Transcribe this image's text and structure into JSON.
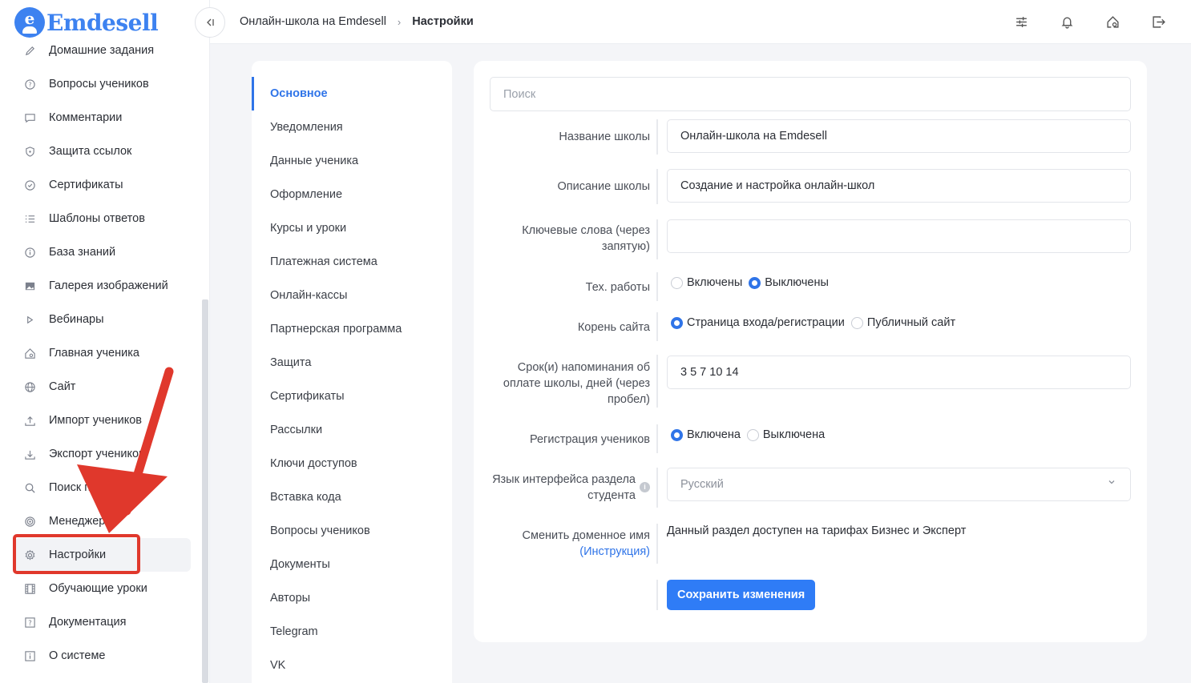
{
  "app": {
    "logo_letter": "e",
    "logo_text": "Emdesell"
  },
  "sidebar": {
    "items": [
      {
        "label": "Домашние задания",
        "icon": "pencil-icon",
        "active": false
      },
      {
        "label": "Вопросы учеников",
        "icon": "question-circle-icon",
        "active": false
      },
      {
        "label": "Комментарии",
        "icon": "comment-icon",
        "active": false
      },
      {
        "label": "Защита ссылок",
        "icon": "shield-icon",
        "active": false
      },
      {
        "label": "Сертификаты",
        "icon": "check-circle-icon",
        "active": false
      },
      {
        "label": "Шаблоны ответов",
        "icon": "list-icon",
        "active": false
      },
      {
        "label": "База знаний",
        "icon": "info-circle-icon",
        "active": false
      },
      {
        "label": "Галерея изображений",
        "icon": "image-icon",
        "active": false
      },
      {
        "label": "Вебинары",
        "icon": "play-icon",
        "active": false
      },
      {
        "label": "Главная ученика",
        "icon": "home-icon",
        "active": false
      },
      {
        "label": "Сайт",
        "icon": "globe-icon",
        "active": false
      },
      {
        "label": "Импорт учеников",
        "icon": "upload-icon",
        "active": false
      },
      {
        "label": "Экспорт учеников",
        "icon": "download-icon",
        "active": false
      },
      {
        "label": "Поиск по кл",
        "icon": "search-icon",
        "active": false
      },
      {
        "label": "Менеджер IP",
        "icon": "target-icon",
        "active": false
      },
      {
        "label": "Настройки",
        "icon": "gear-icon",
        "active": true
      },
      {
        "label": "Обучающие уроки",
        "icon": "film-icon",
        "active": false
      },
      {
        "label": "Документация",
        "icon": "help-square-icon",
        "active": false
      },
      {
        "label": "О системе",
        "icon": "info-square-icon",
        "active": false
      }
    ]
  },
  "topbar": {
    "breadcrumb": {
      "parent": "Онлайн-школа на Emdesell",
      "current": "Настройки"
    },
    "icons": [
      "sliders-icon",
      "bell-icon",
      "home-settings-icon",
      "logout-icon"
    ]
  },
  "settings_menu": {
    "items": [
      {
        "label": "Основное",
        "active": true
      },
      {
        "label": "Уведомления"
      },
      {
        "label": "Данные ученика"
      },
      {
        "label": "Оформление"
      },
      {
        "label": "Курсы и уроки"
      },
      {
        "label": "Платежная система"
      },
      {
        "label": "Онлайн-кассы"
      },
      {
        "label": "Партнерская программа"
      },
      {
        "label": "Защита"
      },
      {
        "label": "Сертификаты"
      },
      {
        "label": "Рассылки"
      },
      {
        "label": "Ключи доступов"
      },
      {
        "label": "Вставка кода"
      },
      {
        "label": "Вопросы учеников"
      },
      {
        "label": "Документы"
      },
      {
        "label": "Авторы"
      },
      {
        "label": "Telegram"
      },
      {
        "label": "VK"
      }
    ]
  },
  "form": {
    "search_placeholder": "Поиск",
    "school_name": {
      "label": "Название школы",
      "value": "Онлайн-школа на Emdesell"
    },
    "school_description": {
      "label": "Описание школы",
      "value": "Создание и настройка онлайн-школ"
    },
    "keywords": {
      "label": "Ключевые слова (через запятую)",
      "value": ""
    },
    "maintenance": {
      "label": "Тех. работы",
      "option_on": "Включены",
      "option_off": "Выключены",
      "selected": "Выключены"
    },
    "site_root": {
      "label": "Корень сайта",
      "option_login": "Страница входа/регистрации",
      "option_public": "Публичный сайт",
      "selected": "Страница входа/регистрации"
    },
    "payment_reminder": {
      "label": "Срок(и) напоминания об оплате школы, дней (через пробел)",
      "value": "3 5 7 10 14"
    },
    "registration": {
      "label": "Регистрация учеников",
      "option_on": "Включена",
      "option_off": "Выключена",
      "selected": "Включена"
    },
    "student_language": {
      "label": "Язык интерфейса раздела студента",
      "value": "Русский",
      "info": "i"
    },
    "domain": {
      "label": "Сменить доменное имя",
      "link": "(Инструкция)",
      "note": "Данный раздел доступен на тарифах Бизнес и Эксперт"
    },
    "save_label": "Сохранить изменения"
  },
  "annotation": {
    "color": "#e0382c"
  }
}
